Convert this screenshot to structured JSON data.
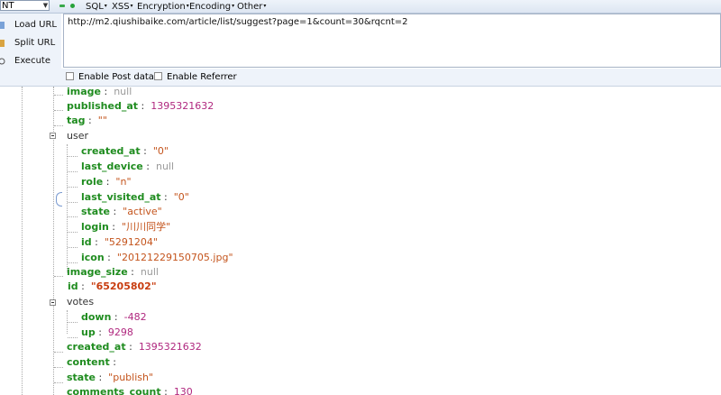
{
  "toolbar": {
    "selector_value": "NT",
    "menus": [
      "SQL",
      "XSS",
      "Encryption",
      "Encoding",
      "Other"
    ]
  },
  "actions": [
    "Load URL",
    "Split URL",
    "Execute"
  ],
  "url_value": "http://m2.qiushibaike.com/article/list/suggest?page=1&count=30&rqcnt=2",
  "options": [
    "Enable Post data",
    "Enable Referrer"
  ],
  "tree": {
    "sep": " :",
    "image": {
      "key": "image",
      "value": "null"
    },
    "published_at": {
      "key": "published_at",
      "value": "1395321632"
    },
    "tag": {
      "key": "tag",
      "value": "\"\""
    },
    "user": {
      "label": "user",
      "created_at": {
        "key": "created_at",
        "value": "\"0\""
      },
      "last_device": {
        "key": "last_device",
        "value": "null"
      },
      "role": {
        "key": "role",
        "value": "\"n\""
      },
      "last_visited_at": {
        "key": "last_visited_at",
        "value": "\"0\""
      },
      "state": {
        "key": "state",
        "value": "\"active\""
      },
      "login": {
        "key": "login",
        "value": "\"川川同学\""
      },
      "id": {
        "key": "id",
        "value": "\"5291204\""
      },
      "icon": {
        "key": "icon",
        "value": "\"20121229150705.jpg\""
      }
    },
    "image_size": {
      "key": "image_size",
      "value": "null"
    },
    "id": {
      "key": "id",
      "value": "\"65205802\""
    },
    "votes": {
      "label": "votes",
      "down": {
        "key": "down",
        "value": "-482"
      },
      "up": {
        "key": "up",
        "value": "9298"
      }
    },
    "created_at": {
      "key": "created_at",
      "value": "1395321632"
    },
    "content": {
      "key": "content",
      "value": ""
    },
    "state": {
      "key": "state",
      "value": "\"publish\""
    },
    "comments_count": {
      "key": "comments_count",
      "value": "130"
    }
  }
}
